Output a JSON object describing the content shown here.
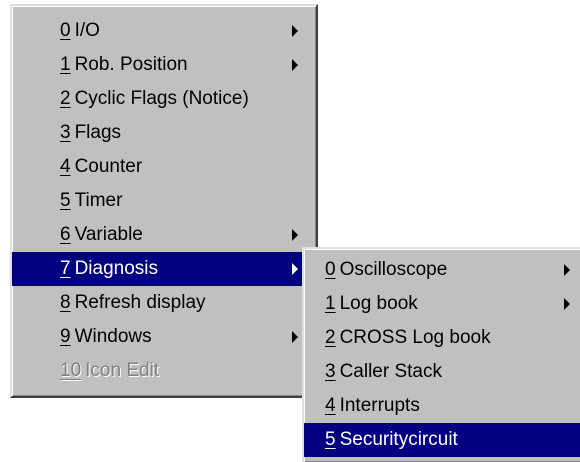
{
  "main_menu": {
    "items": [
      {
        "mnemonic": "0",
        "label": "I/O",
        "submenu": true
      },
      {
        "mnemonic": "1",
        "label": "Rob. Position",
        "submenu": true
      },
      {
        "mnemonic": "2",
        "label": "Cyclic Flags (Notice)",
        "submenu": false
      },
      {
        "mnemonic": "3",
        "label": "Flags",
        "submenu": false
      },
      {
        "mnemonic": "4",
        "label": "Counter",
        "submenu": false
      },
      {
        "mnemonic": "5",
        "label": "Timer",
        "submenu": false
      },
      {
        "mnemonic": "6",
        "label": "Variable",
        "submenu": true
      },
      {
        "mnemonic": "7",
        "label": "Diagnosis",
        "submenu": true,
        "selected": true
      },
      {
        "mnemonic": "8",
        "label": "Refresh display",
        "submenu": false
      },
      {
        "mnemonic": "9",
        "label": "Windows",
        "submenu": true
      },
      {
        "mnemonic": "10",
        "label": "Icon Edit",
        "submenu": false,
        "disabled": true
      }
    ]
  },
  "diagnosis_submenu": {
    "items": [
      {
        "mnemonic": "0",
        "label": "Oscilloscope",
        "submenu": true
      },
      {
        "mnemonic": "1",
        "label": "Log book",
        "submenu": true
      },
      {
        "mnemonic": "2",
        "label": "CROSS Log book",
        "submenu": false
      },
      {
        "mnemonic": "3",
        "label": "Caller Stack",
        "submenu": false
      },
      {
        "mnemonic": "4",
        "label": "Interrupts",
        "submenu": false
      },
      {
        "mnemonic": "5",
        "label": "Securitycircuit",
        "submenu": false,
        "selected": true
      }
    ]
  },
  "colors": {
    "menu_background": "#c0c0c0",
    "highlight": "#000080",
    "disabled_text": "#808080"
  },
  "icons": {
    "submenu_arrow": "submenu-arrow-icon"
  }
}
